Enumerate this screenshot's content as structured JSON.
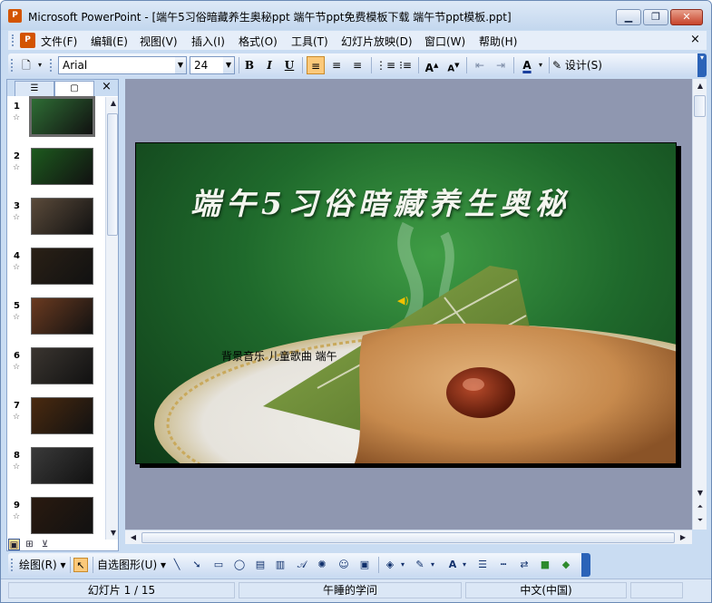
{
  "window": {
    "title": "Microsoft PowerPoint - [端午5习俗暗藏养生奥秘ppt 端午节ppt免费模板下载  端午节ppt模板.ppt]",
    "app_icon": "powerpoint-icon",
    "minimize": "▁",
    "restore": "❐",
    "close": "✕"
  },
  "menu": {
    "items": [
      "文件(F)",
      "编辑(E)",
      "视图(V)",
      "插入(I)",
      "格式(O)",
      "工具(T)",
      "幻灯片放映(D)",
      "窗口(W)",
      "帮助(H)"
    ],
    "close": "×"
  },
  "toolbar": {
    "font_name": "Arial",
    "font_size": "24",
    "bold": "B",
    "italic": "I",
    "underline": "U",
    "design_label": "设计(S)"
  },
  "slides_panel": {
    "tab_outline_icon": "outline-icon",
    "tab_slides_icon": "slides-icon",
    "close": "×",
    "slides": [
      {
        "number": "1",
        "color": "#2e6d34"
      },
      {
        "number": "2",
        "color": "#1d5a1e"
      },
      {
        "number": "3",
        "color": "#5a4a3a"
      },
      {
        "number": "4",
        "color": "#2a2016"
      },
      {
        "number": "5",
        "color": "#6a3a20"
      },
      {
        "number": "6",
        "color": "#3a3530"
      },
      {
        "number": "7",
        "color": "#4a2a10"
      },
      {
        "number": "8",
        "color": "#3a3a3a"
      },
      {
        "number": "9",
        "color": "#2a1a10"
      }
    ],
    "current_slide": 1
  },
  "slide": {
    "title": "端午5习俗暗藏养生奥秘",
    "music_caption": "背景音乐 儿童歌曲 端午"
  },
  "drawing_toolbar": {
    "draw_label": "绘图(R)",
    "autoshapes_label": "自选图形(U)"
  },
  "status": {
    "slide_indicator": "幻灯片 1 / 15",
    "design_template": "午睡的学问",
    "language": "中文(中国)"
  }
}
